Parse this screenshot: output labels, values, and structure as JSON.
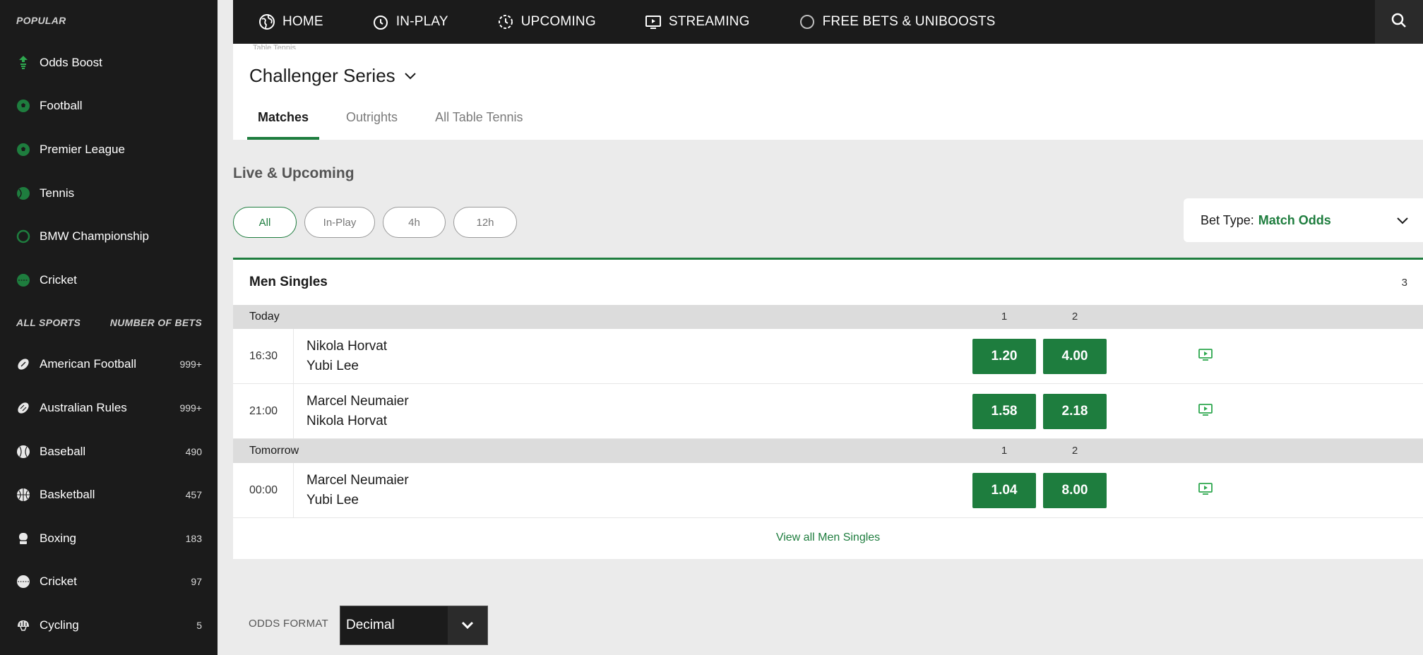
{
  "sidebar": {
    "popular_heading": "POPULAR",
    "popular": [
      {
        "label": "Odds Boost",
        "icon": "odds-boost-icon"
      },
      {
        "label": "Football",
        "icon": "football-icon"
      },
      {
        "label": "Premier League",
        "icon": "football-icon"
      },
      {
        "label": "Tennis",
        "icon": "tennis-icon"
      },
      {
        "label": "BMW Championship",
        "icon": "golf-icon"
      },
      {
        "label": "Cricket",
        "icon": "cricket-icon"
      }
    ],
    "all_sports_heading": "ALL SPORTS",
    "number_of_bets_heading": "NUMBER OF BETS",
    "sports": [
      {
        "label": "American Football",
        "count": "999+"
      },
      {
        "label": "Australian Rules",
        "count": "999+"
      },
      {
        "label": "Baseball",
        "count": "490"
      },
      {
        "label": "Basketball",
        "count": "457"
      },
      {
        "label": "Boxing",
        "count": "183"
      },
      {
        "label": "Cricket",
        "count": "97"
      },
      {
        "label": "Cycling",
        "count": "5"
      }
    ]
  },
  "nav": {
    "items": [
      {
        "label": "HOME",
        "icon": "globe-icon"
      },
      {
        "label": "IN-PLAY",
        "icon": "stopwatch-icon"
      },
      {
        "label": "UPCOMING",
        "icon": "clock-dashed-icon"
      },
      {
        "label": "STREAMING",
        "icon": "tv-icon"
      },
      {
        "label": "FREE BETS & UNIBOOSTS",
        "icon": "circle-icon"
      }
    ]
  },
  "header": {
    "breadcrumb": "Table Tennis",
    "title": "Challenger Series",
    "tabs": [
      "Matches",
      "Outrights",
      "All Table Tennis"
    ]
  },
  "live": {
    "title": "Live & Upcoming",
    "filters": [
      "All",
      "In-Play",
      "4h",
      "12h"
    ],
    "bet_type_label": "Bet Type:",
    "bet_type_value": "Match Odds"
  },
  "section": {
    "name": "Men Singles",
    "count": "3",
    "groups": [
      {
        "day": "Today",
        "col1": "1",
        "col2": "2",
        "matches": [
          {
            "time": "16:30",
            "home": "Nikola Horvat",
            "away": "Yubi Lee",
            "odd1": "1.20",
            "odd2": "4.00"
          },
          {
            "time": "21:00",
            "home": "Marcel Neumaier",
            "away": "Nikola Horvat",
            "odd1": "1.58",
            "odd2": "2.18"
          }
        ]
      },
      {
        "day": "Tomorrow",
        "col1": "1",
        "col2": "2",
        "matches": [
          {
            "time": "00:00",
            "home": "Marcel Neumaier",
            "away": "Yubi Lee",
            "odd1": "1.04",
            "odd2": "8.00"
          }
        ]
      }
    ],
    "view_all": "View all Men Singles"
  },
  "footer": {
    "odds_format_label": "ODDS FORMAT",
    "odds_format_value": "Decimal"
  },
  "colors": {
    "brand_green": "#1e7d3e",
    "dark": "#1b1b1b"
  }
}
